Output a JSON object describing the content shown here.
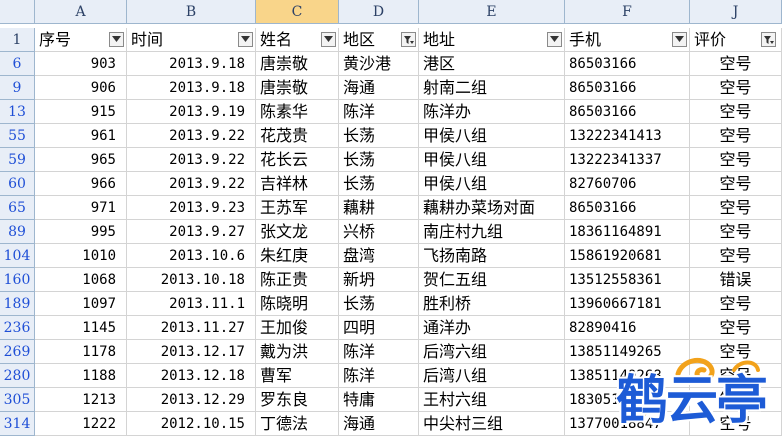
{
  "sheet": {
    "column_letters": [
      "A",
      "B",
      "C",
      "D",
      "E",
      "F",
      "J"
    ],
    "header": {
      "row_number": "1",
      "cols": [
        "序号",
        "时间",
        "姓名",
        "地区",
        "地址",
        "手机",
        "评价"
      ]
    },
    "rows": [
      {
        "n": "6",
        "a": "903",
        "b": "2013.9.18",
        "c": "唐崇敬",
        "d": "黄沙港",
        "e": "港区",
        "f": "86503166",
        "j": "空号"
      },
      {
        "n": "9",
        "a": "906",
        "b": "2013.9.18",
        "c": "唐崇敬",
        "d": "海通",
        "e": "射南二组",
        "f": "86503166",
        "j": "空号"
      },
      {
        "n": "13",
        "a": "915",
        "b": "2013.9.19",
        "c": "陈素华",
        "d": "陈洋",
        "e": "陈洋办",
        "f": "86503166",
        "j": "空号"
      },
      {
        "n": "55",
        "a": "961",
        "b": "2013.9.22",
        "c": "花茂贵",
        "d": "长荡",
        "e": "甲侯八组",
        "f": "13222341413",
        "j": "空号"
      },
      {
        "n": "59",
        "a": "965",
        "b": "2013.9.22",
        "c": "花长云",
        "d": "长荡",
        "e": "甲侯八组",
        "f": "13222341337",
        "j": "空号"
      },
      {
        "n": "60",
        "a": "966",
        "b": "2013.9.22",
        "c": "吉祥林",
        "d": "长荡",
        "e": "甲侯八组",
        "f": "82760706",
        "j": "空号"
      },
      {
        "n": "65",
        "a": "971",
        "b": "2013.9.23",
        "c": "王苏军",
        "d": "藕耕",
        "e": "藕耕办菜场对面",
        "f": "86503166",
        "j": "空号"
      },
      {
        "n": "89",
        "a": "995",
        "b": "2013.9.27",
        "c": "张文龙",
        "d": "兴桥",
        "e": "南庄村九组",
        "f": "18361164891",
        "j": "空号"
      },
      {
        "n": "104",
        "a": "1010",
        "b": "2013.10.6",
        "c": "朱红庚",
        "d": "盘湾",
        "e": "飞扬南路",
        "f": "15861920681",
        "j": "空号"
      },
      {
        "n": "160",
        "a": "1068",
        "b": "2013.10.18",
        "c": "陈正贵",
        "d": "新坍",
        "e": "贺仁五组",
        "f": "13512558361",
        "j": "错误"
      },
      {
        "n": "189",
        "a": "1097",
        "b": "2013.11.1",
        "c": "陈晓明",
        "d": "长荡",
        "e": "胜利桥",
        "f": "13960667181",
        "j": "空号"
      },
      {
        "n": "236",
        "a": "1145",
        "b": "2013.11.27",
        "c": "王加俊",
        "d": "四明",
        "e": "通洋办",
        "f": "82890416",
        "j": "空号"
      },
      {
        "n": "269",
        "a": "1178",
        "b": "2013.12.17",
        "c": "戴为洪",
        "d": "陈洋",
        "e": "后湾六组",
        "f": "13851149265",
        "j": "空号"
      },
      {
        "n": "280",
        "a": "1188",
        "b": "2013.12.18",
        "c": "曹军",
        "d": "陈洋",
        "e": "后湾八组",
        "f": "13851149268",
        "j": "空号"
      },
      {
        "n": "305",
        "a": "1213",
        "b": "2013.12.29",
        "c": "罗东良",
        "d": "特庸",
        "e": "王村六组",
        "f": "18305147216",
        "j": "错误"
      },
      {
        "n": "314",
        "a": "1222",
        "b": "2012.10.15",
        "c": "丁德法",
        "d": "海通",
        "e": "中尖村三组",
        "f": "13770018847",
        "j": "空号"
      }
    ]
  },
  "colors": {
    "header_bg": "#e8eef7",
    "selected_col_bg": "#f9d58a",
    "filtered_row_num": "#1f4fd6",
    "logo_blue": "#1d5bd6"
  },
  "watermark": {
    "text": "鹤云亭"
  }
}
